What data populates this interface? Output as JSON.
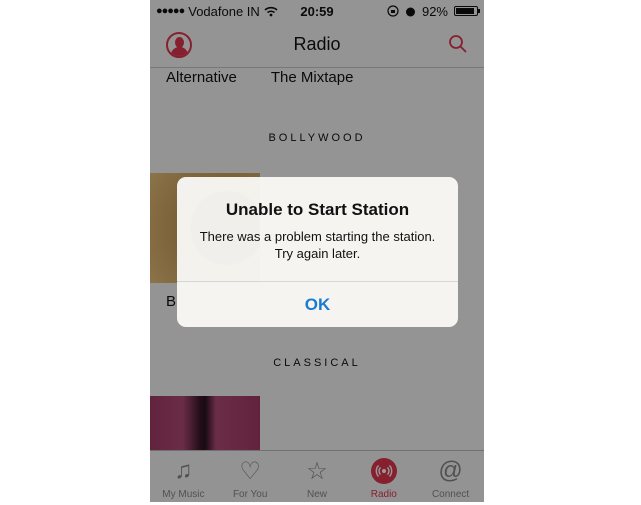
{
  "status_bar": {
    "signal_dots": "●●●●●",
    "carrier": "Vodafone IN",
    "time": "20:59",
    "battery_percent_label": "92%",
    "battery_level": 0.92
  },
  "nav": {
    "title": "Radio"
  },
  "content": {
    "genres": [
      "Alternative",
      "The Mixtape"
    ],
    "sections": {
      "bollywood": "BOLLYWOOD",
      "bollywood_item_initial": "B",
      "classical": "CLASSICAL"
    }
  },
  "alert": {
    "title": "Unable to Start Station",
    "message": "There was a problem starting the station. Try again later.",
    "ok_label": "OK"
  },
  "tabs": [
    {
      "label": "My Music",
      "icon": "music-note-icon",
      "active": false
    },
    {
      "label": "For You",
      "icon": "heart-icon",
      "active": false
    },
    {
      "label": "New",
      "icon": "star-icon",
      "active": false
    },
    {
      "label": "Radio",
      "icon": "radio-broadcast-icon",
      "active": true
    },
    {
      "label": "Connect",
      "icon": "at-sign-icon",
      "active": false
    }
  ],
  "colors": {
    "accent": "#e0364f",
    "link": "#1b7bd0"
  }
}
